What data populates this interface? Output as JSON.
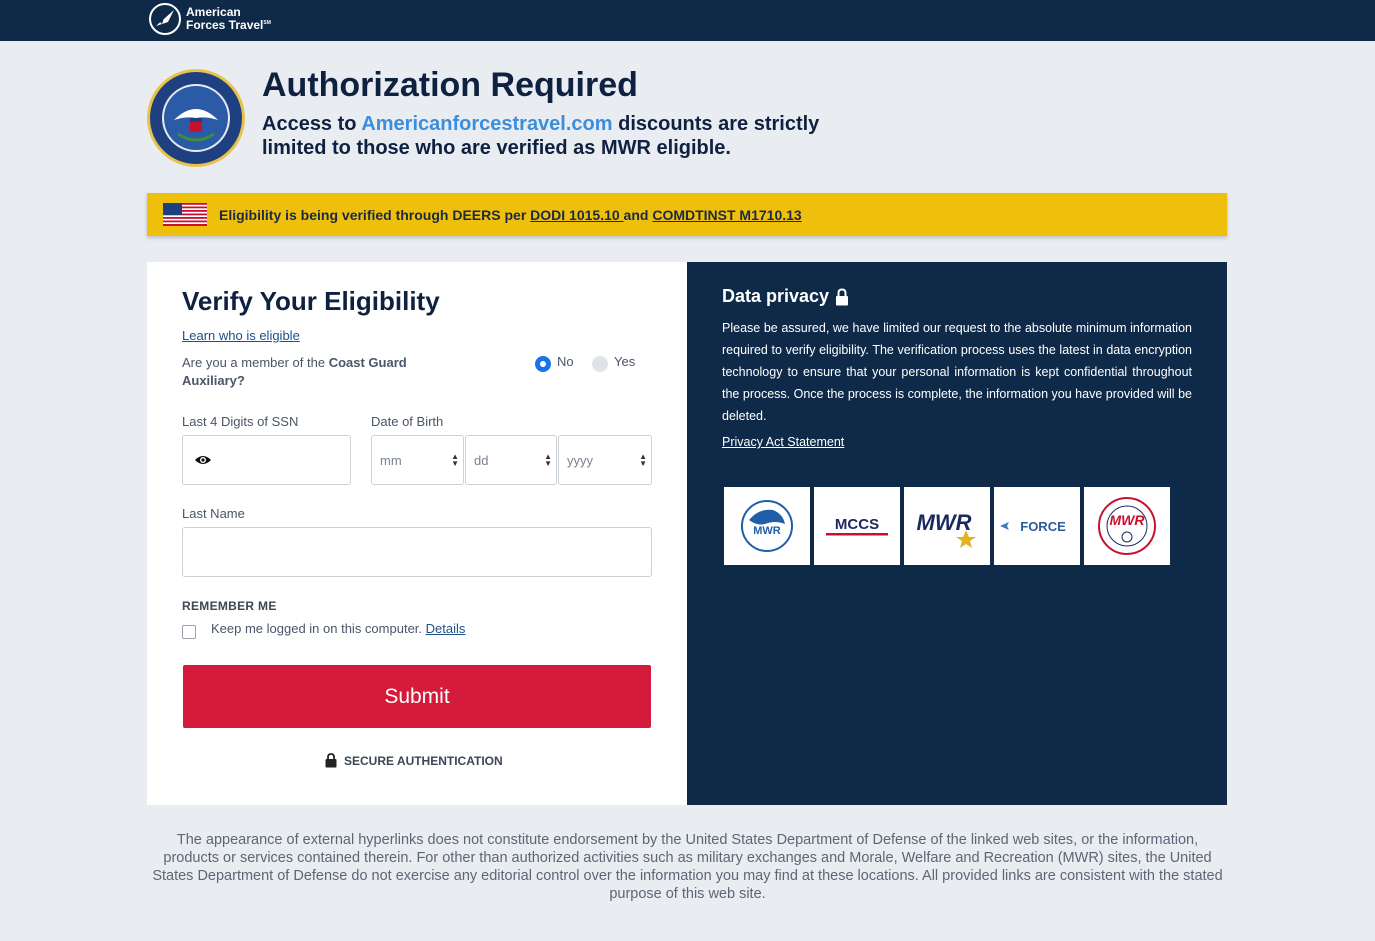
{
  "header": {
    "brand_line1": "American",
    "brand_line2": "Forces Travel",
    "brand_tm": "SM"
  },
  "hero": {
    "seal_alt": "department-of-defense-seal",
    "title": "Authorization Required",
    "subtitle_pre": "Access to ",
    "subtitle_link": "Americanforcestravel.com",
    "subtitle_post": " discounts are strictly limited to those who are verified as MWR eligible."
  },
  "banner": {
    "text_pre": "Eligibility is being verified through DEERS per ",
    "link1": "DODI 1015.10 ",
    "text_mid": "and ",
    "link2": "COMDTINST M1710.13",
    "color": "#efc00b"
  },
  "form": {
    "title": "Verify Your Eligibility",
    "learn_link": "Learn who is eligible",
    "cg_question_pre": "Are you a member of the ",
    "cg_question_bold": "Coast Guard Auxiliary?",
    "radio_no": "No",
    "radio_yes": "Yes",
    "selected_radio": "No",
    "ssn_label": "Last 4 Digits of SSN",
    "dob_label": "Date of Birth",
    "dob_month": "mm",
    "dob_day": "dd",
    "dob_year": "yyyy",
    "lastname_label": "Last Name",
    "remember_heading": "REMEMBER ME",
    "remember_text": "Keep me logged in on this computer. ",
    "remember_link": "Details",
    "submit_label": "Submit",
    "secure_label": "SECURE AUTHENTICATION",
    "accent_color": "#d41b3b"
  },
  "privacy": {
    "title": "Data privacy",
    "body": "Please be assured, we have limited our request to the absolute minimum information required to verify eligibility. The verification process uses the latest in data encryption technology to ensure that your personal information is kept confidential throughout the process. Once the process is complete, the information you have provided will be deleted.",
    "link": "Privacy Act Statement",
    "logos": [
      "us-army-mwr-logo",
      "mccs-logo",
      "mwr-army-logo",
      "air-force-force-logo",
      "coast-guard-mwr-logo"
    ],
    "logo_text": [
      "MWR",
      "MCCS",
      "MWR",
      "FORCE",
      "MWR"
    ],
    "bg_color": "#0f2a48"
  },
  "footer": {
    "disclaimer": "The appearance of external hyperlinks does not constitute endorsement by the United States Department of Defense of the linked web sites, or the information, products or services contained therein. For other than authorized activities such as military exchanges and Morale, Welfare and Recreation (MWR) sites, the United States Department of Defense do not exercise any editorial control over the information you may find at these locations. All provided links are consistent with the stated purpose of this web site."
  }
}
